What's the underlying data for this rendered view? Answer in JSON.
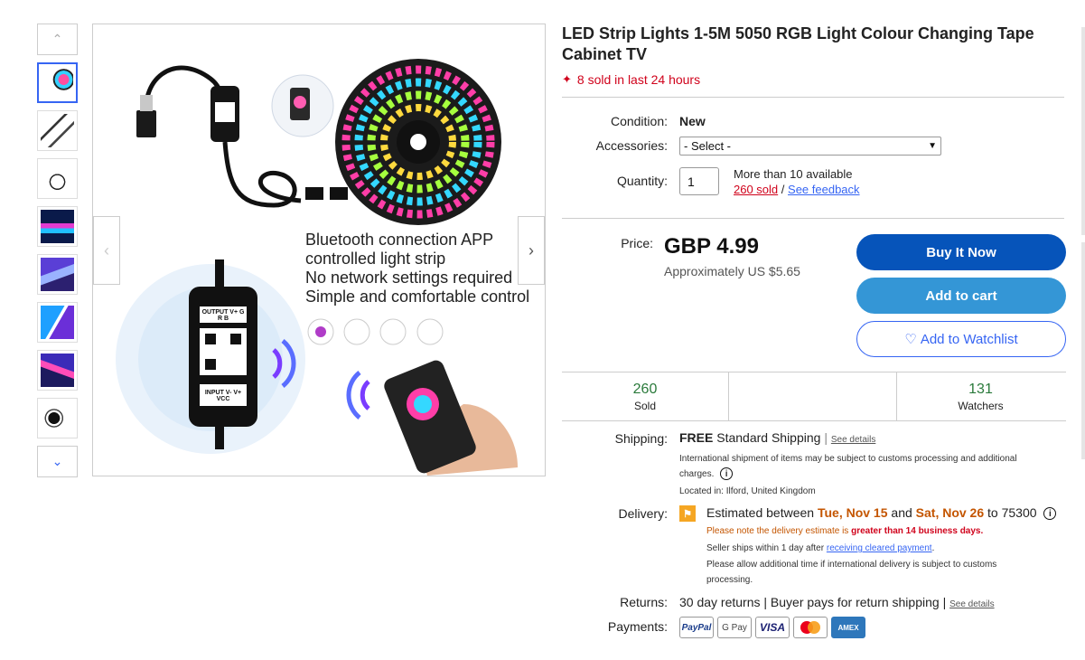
{
  "gallery": {
    "thumb_count": 8,
    "img_lines": [
      "Bluetooth connection APP",
      "controlled light strip",
      "No network settings required",
      "Simple and comfortable control"
    ],
    "module_label_top": "OUTPUT V+ G R B",
    "module_label_bottom": "INPUT V- V+ VCC"
  },
  "listing": {
    "title": "LED Strip Lights 1-5M 5050 RGB Light Colour Changing Tape Cabinet TV",
    "sold_24": "8 sold in last 24 hours"
  },
  "details": {
    "condition_label": "Condition:",
    "condition_value": "New",
    "accessories_label": "Accessories:",
    "accessories_selected": "- Select -",
    "quantity_label": "Quantity:",
    "quantity_value": "1",
    "available": "More than 10 available",
    "sold_link": "260 sold",
    "separator": "/",
    "feedback_link": "See feedback"
  },
  "pricing": {
    "price_label": "Price:",
    "price": "GBP 4.99",
    "approx": "Approximately US $5.65",
    "buy_now": "Buy It Now",
    "add_to_cart": "Add to cart",
    "add_to_watchlist": "Add to Watchlist"
  },
  "stats": {
    "sold_num": "260",
    "sold_label": "Sold",
    "watchers_num": "131",
    "watchers_label": "Watchers"
  },
  "shipping": {
    "label": "Shipping:",
    "free": "FREE",
    "standard": "Standard Shipping",
    "pipe": "|",
    "see_details": "See details",
    "note_line1": "International shipment of items may be subject to customs processing and additional",
    "note_line2": "charges.",
    "located": "Located in: Ilford, United Kingdom"
  },
  "delivery": {
    "label": "Delivery:",
    "est_prefix": "Estimated between",
    "date1": "Tue, Nov 15",
    "and": "and",
    "date2": "Sat, Nov 26",
    "to": "to 75300",
    "note1_a": "Please note the delivery estimate is",
    "note1_b": "greater than 14 business days.",
    "note2_a": "Seller ships within 1 day after",
    "note2_link": "receiving cleared payment",
    "note2_end": ".",
    "note3_line1": "Please allow additional time if international delivery is subject to customs",
    "note3_line2": "processing."
  },
  "returns": {
    "label": "Returns:",
    "text": "30 day returns | Buyer pays for return shipping |",
    "see_details": "See details"
  },
  "payments": {
    "label": "Payments:",
    "methods": [
      "PayPal",
      "G Pay",
      "VISA",
      "Mastercard",
      "AMEX"
    ]
  },
  "colors": {
    "accent_blue": "#0654ba",
    "cart_blue": "#3496d6",
    "link_blue": "#3665f3",
    "red": "#d0021b",
    "green": "#2a7a3b",
    "orange": "#c45500"
  }
}
